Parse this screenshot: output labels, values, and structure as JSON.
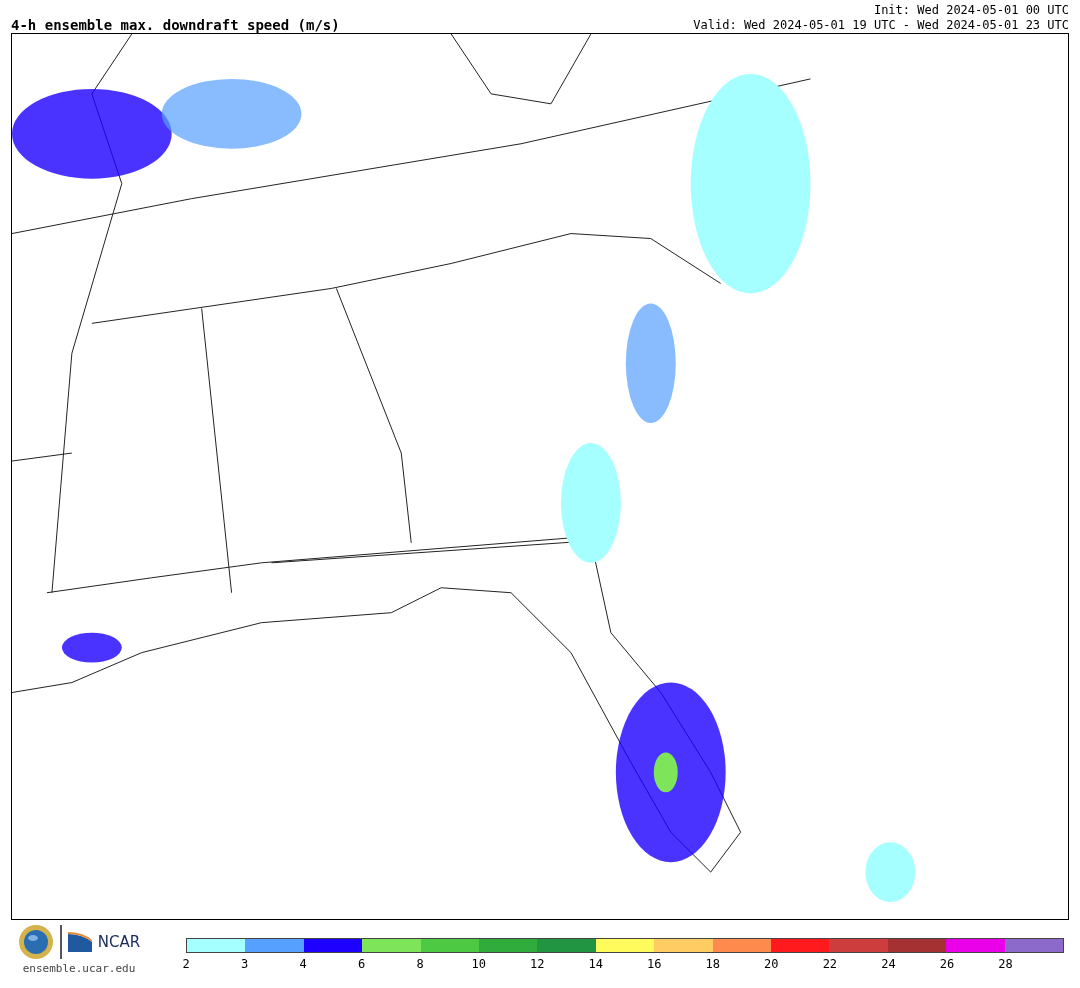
{
  "header": {
    "title": "4-h ensemble max. downdraft speed (m/s)",
    "init": "Init: Wed 2024-05-01 00 UTC",
    "valid": "Valid: Wed 2024-05-01 19 UTC - Wed 2024-05-01 23 UTC"
  },
  "footer": {
    "org": "NCAR",
    "url": "ensemble.ucar.edu"
  },
  "colorbar": {
    "bins": [
      {
        "color": "#a6ffff",
        "label": "2"
      },
      {
        "color": "#56a0ff",
        "label": "3"
      },
      {
        "color": "#1e00ff",
        "label": "4"
      },
      {
        "color": "#7ee45a",
        "label": "6"
      },
      {
        "color": "#4dc944",
        "label": "8"
      },
      {
        "color": "#2fac3c",
        "label": "10"
      },
      {
        "color": "#229542",
        "label": "12"
      },
      {
        "color": "#fffb5d",
        "label": "14"
      },
      {
        "color": "#ffcb63",
        "label": "16"
      },
      {
        "color": "#ff8a4d",
        "label": "18"
      },
      {
        "color": "#ff1a1e",
        "label": "20"
      },
      {
        "color": "#cd3d3e",
        "label": "22"
      },
      {
        "color": "#a53132",
        "label": "24"
      },
      {
        "color": "#ea00e9",
        "label": "26"
      },
      {
        "color": "#8b6acc",
        "label": "28"
      }
    ]
  }
}
